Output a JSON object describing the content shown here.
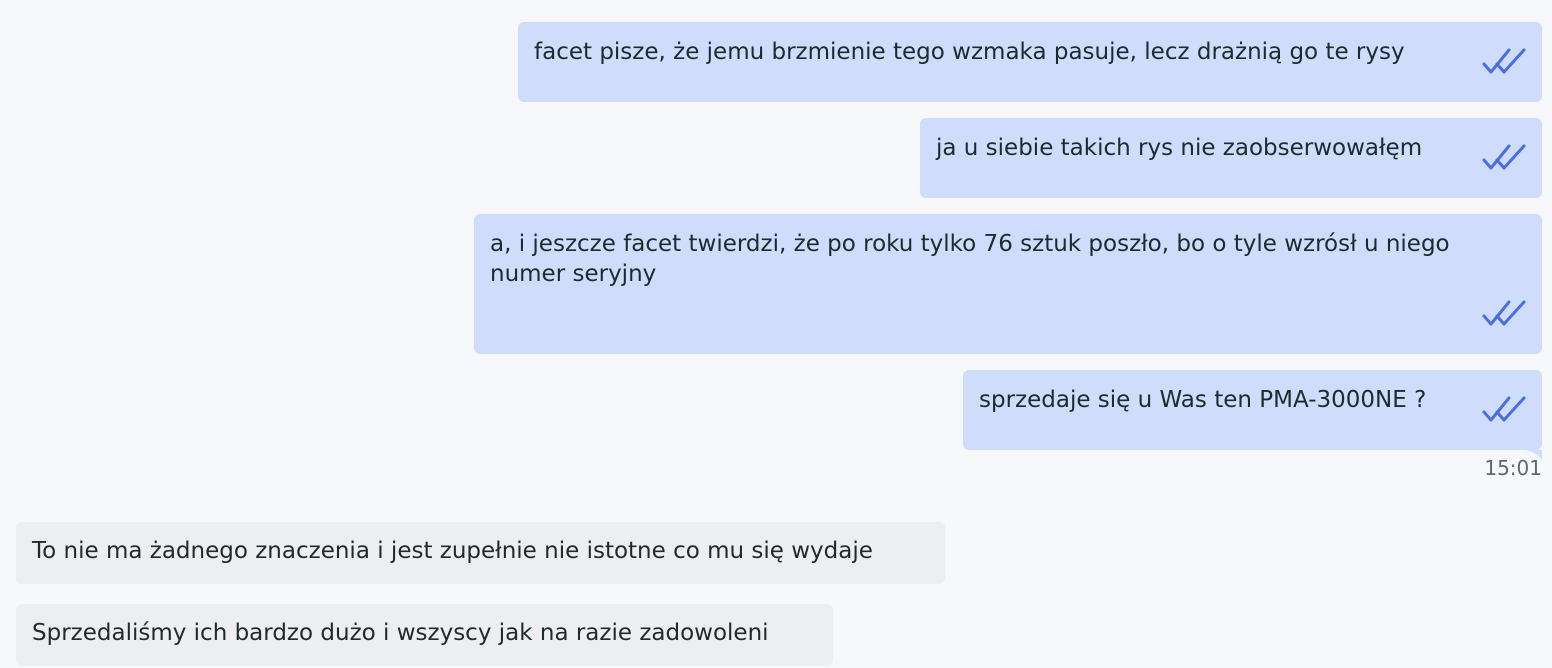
{
  "messages": [
    {
      "direction": "sent",
      "text": "facet pisze, że jemu brzmienie tego wzmaka pasuje, lecz drażnią go te rysy",
      "status_icon": "double-check-icon"
    },
    {
      "direction": "sent",
      "text": "ja u siebie takich rys nie zaobserwowałęm",
      "status_icon": "double-check-icon"
    },
    {
      "direction": "sent",
      "text": "a, i jeszcze facet twierdzi, że po roku tylko 76 sztuk poszło, bo o tyle wzrósł u niego numer seryjny",
      "status_icon": "double-check-icon"
    },
    {
      "direction": "sent",
      "text": "sprzedaje się u Was ten PMA-3000NE ?",
      "status_icon": "double-check-icon"
    },
    {
      "direction": "received",
      "text": "To nie ma żadnego znaczenia i jest zupełnie nie istotne co mu się wydaje"
    },
    {
      "direction": "received",
      "text": "Sprzedaliśmy ich bardzo dużo i wszyscy jak na razie zadowoleni"
    }
  ],
  "sent_group_time": "15:01",
  "colors": {
    "background": "#f6f8f9",
    "sent_bubble": "#cfdcfb",
    "received_bubble": "#eceef0",
    "check": "#4a6ee0",
    "text": "#1f2a2e",
    "timestamp": "#5e6a70"
  }
}
